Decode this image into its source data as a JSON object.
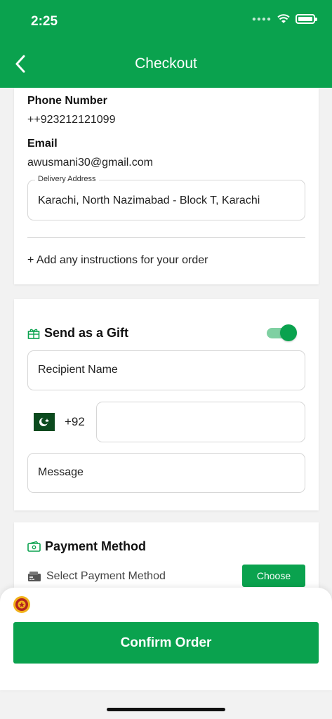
{
  "status_bar": {
    "time": "2:25"
  },
  "header": {
    "title": "Checkout",
    "accent": "#0aa24e"
  },
  "contact": {
    "phone_label": "Phone Number",
    "phone_value": "++923212121099",
    "email_label": "Email",
    "email_value": "awusmani30@gmail.com",
    "address_label": "Delivery Address",
    "address_value": "Karachi, North Nazimabad - Block T, Karachi",
    "instructions_link": "+ Add any instructions for your order"
  },
  "gift": {
    "title": "Send as a Gift",
    "toggle_on": true,
    "recipient_placeholder": "Recipient Name",
    "country_code": "+92",
    "phone_value": "",
    "message_placeholder": "Message"
  },
  "payment": {
    "title": "Payment Method",
    "select_label": "Select Payment Method",
    "choose_button": "Choose"
  },
  "footer": {
    "confirm_button": "Confirm Order"
  }
}
